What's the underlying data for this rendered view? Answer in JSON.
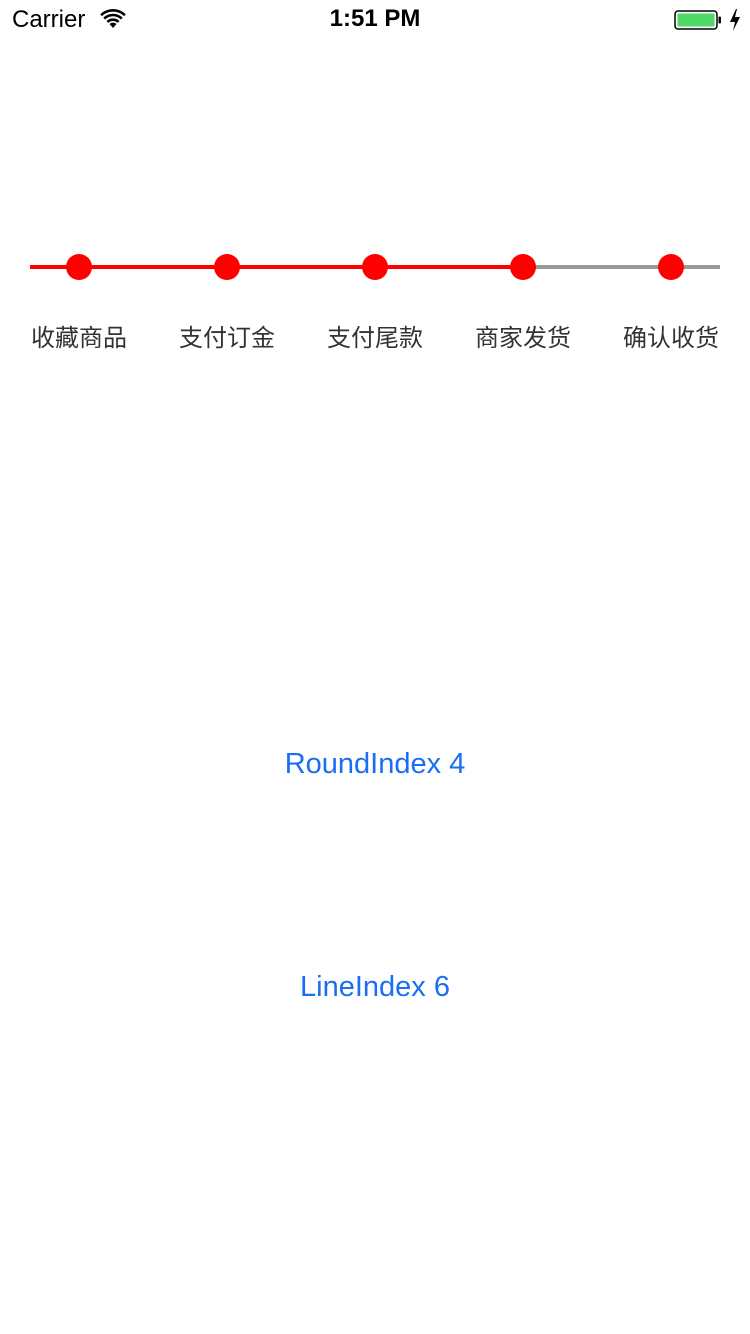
{
  "status_bar": {
    "carrier": "Carrier",
    "time": "1:51 PM",
    "battery_color": "#4cd964",
    "wifi_icon": "wifi-icon",
    "battery_icon": "battery-icon",
    "charging_icon": "charging-bolt-icon"
  },
  "stepper": {
    "active_color": "#ff0000",
    "inactive_color": "#999999",
    "dot_color": "#ff0000",
    "completed_steps": 4,
    "steps": [
      {
        "label": "收藏商品"
      },
      {
        "label": "支付订金"
      },
      {
        "label": "支付尾款"
      },
      {
        "label": "商家发货"
      },
      {
        "label": "确认收货"
      }
    ]
  },
  "round_index": {
    "label": "RoundIndex 4"
  },
  "line_index": {
    "label": "LineIndex 6"
  },
  "colors": {
    "link": "#1a6ef5",
    "label_text": "#333333"
  }
}
